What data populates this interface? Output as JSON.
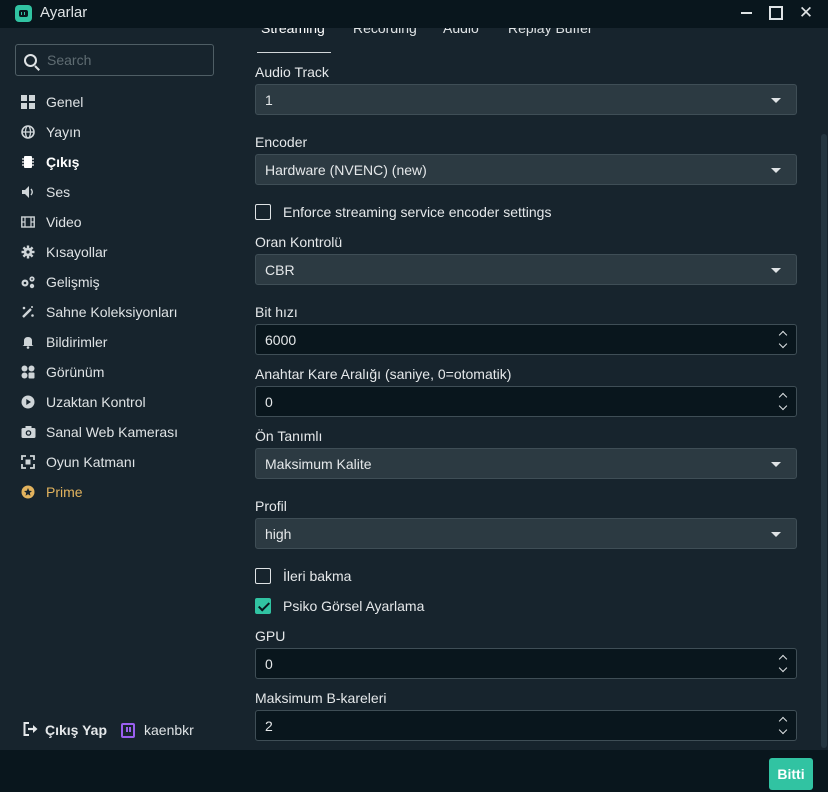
{
  "window": {
    "title": "Ayarlar"
  },
  "search": {
    "placeholder": "Search"
  },
  "sidebar": {
    "items": [
      {
        "label": "Genel",
        "icon": "grid-icon"
      },
      {
        "label": "Yayın",
        "icon": "globe-icon"
      },
      {
        "label": "Çıkış",
        "icon": "chip-icon"
      },
      {
        "label": "Ses",
        "icon": "speaker-icon"
      },
      {
        "label": "Video",
        "icon": "film-icon"
      },
      {
        "label": "Kısayollar",
        "icon": "gear-icon"
      },
      {
        "label": "Gelişmiş",
        "icon": "gears-icon"
      },
      {
        "label": "Sahne Koleksiyonları",
        "icon": "magic-icon"
      },
      {
        "label": "Bildirimler",
        "icon": "bell-icon"
      },
      {
        "label": "Görünüm",
        "icon": "layout-icon"
      },
      {
        "label": "Uzaktan Kontrol",
        "icon": "play-icon"
      },
      {
        "label": "Sanal Web Kamerası",
        "icon": "camera-icon"
      },
      {
        "label": "Oyun Katmanı",
        "icon": "expand-icon"
      },
      {
        "label": "Prime",
        "icon": "prime-icon"
      }
    ],
    "active_index": 2,
    "logout_label": "Çıkış Yap",
    "username": "kaenbkr"
  },
  "tabs": [
    {
      "label": "Streaming"
    },
    {
      "label": "Recording"
    },
    {
      "label": "Audio"
    },
    {
      "label": "Replay Buffer"
    }
  ],
  "form": {
    "audio_track": {
      "label": "Audio Track",
      "value": "1"
    },
    "encoder": {
      "label": "Encoder",
      "value": "Hardware (NVENC) (new)"
    },
    "enforce": {
      "label": "Enforce streaming service encoder settings",
      "checked": false
    },
    "rate_control": {
      "label": "Oran Kontrolü",
      "value": "CBR"
    },
    "bitrate": {
      "label": "Bit hızı",
      "value": "6000"
    },
    "keyframe": {
      "label": "Anahtar Kare Aralığı (saniye, 0=otomatik)",
      "value": "0"
    },
    "preset": {
      "label": "Ön Tanımlı",
      "value": "Maksimum Kalite"
    },
    "profile": {
      "label": "Profil",
      "value": "high"
    },
    "lookahead": {
      "label": "İleri bakma",
      "checked": false
    },
    "psycho": {
      "label": "Psiko Görsel Ayarlama",
      "checked": true
    },
    "gpu": {
      "label": "GPU",
      "value": "0"
    },
    "bframes": {
      "label": "Maksimum B-kareleri",
      "value": "2"
    }
  },
  "done_label": "Bitti",
  "colors": {
    "accent": "#31c3a2",
    "prime": "#e2b35e",
    "twitch": "#9a5fef",
    "panel": "#17242d",
    "background": "#09161d"
  }
}
